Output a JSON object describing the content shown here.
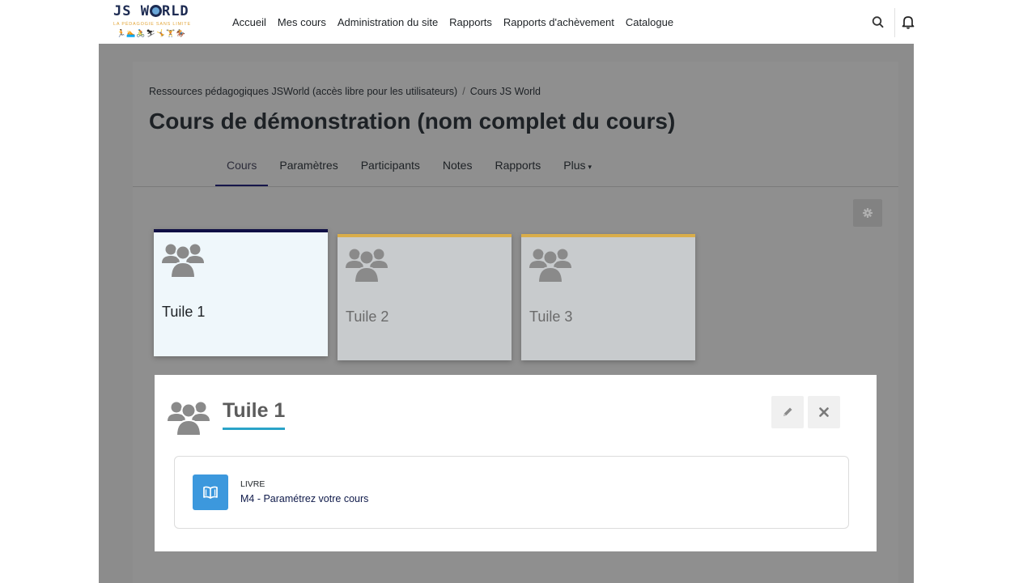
{
  "logo": {
    "text_before": "JS W",
    "text_after": "RLD",
    "tagline": "LA PÉDAGOGIE SANS LIMITE",
    "figures": "🏃🏊🚴⛷🤸🏋🏇"
  },
  "nav": {
    "links": [
      "Accueil",
      "Mes cours",
      "Administration du site",
      "Rapports",
      "Rapports d'achèvement",
      "Catalogue"
    ],
    "search_icon": "search-icon",
    "bell_icon": "bell-icon"
  },
  "breadcrumb": {
    "items": [
      "Ressources pédagogiques JSWorld (accès libre pour les utilisateurs)",
      "Cours JS World"
    ],
    "separator": "/"
  },
  "page": {
    "title": "Cours de démonstration (nom complet du cours)"
  },
  "tabs": [
    {
      "label": "Cours",
      "active": true
    },
    {
      "label": "Paramètres"
    },
    {
      "label": "Participants"
    },
    {
      "label": "Notes"
    },
    {
      "label": "Rapports"
    },
    {
      "label": "Plus",
      "chevron": "▾"
    }
  ],
  "tiles": [
    {
      "label": "Tuile 1",
      "active": true,
      "icon": "users-icon"
    },
    {
      "label": "Tuile 2",
      "active": false,
      "icon": "users-icon"
    },
    {
      "label": "Tuile 3",
      "active": false,
      "icon": "users-icon"
    }
  ],
  "expanded_section": {
    "title": "Tuile 1",
    "icon": "users-icon",
    "edit_icon": "pencil-icon",
    "close_icon": "close-icon",
    "activity": {
      "type": "LIVRE",
      "name": "M4 - Paramétrez votre cours",
      "icon": "book-icon"
    }
  },
  "colors": {
    "active_tile_bar": "#0f0f45",
    "tile_bar": "#d9ad4a",
    "title_underline": "#2aa3c8",
    "activity_icon_bg": "#3c98dd"
  }
}
